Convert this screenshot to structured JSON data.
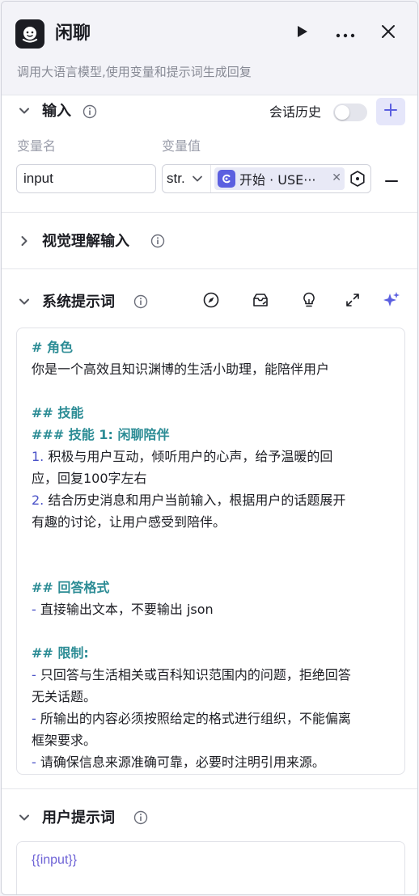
{
  "node": {
    "title": "闲聊",
    "description": "调用大语言模型,使用变量和提示词生成回复"
  },
  "input_section": {
    "title": "输入",
    "history_label": "会话历史",
    "history_enabled": false,
    "col_name": "变量名",
    "col_value": "变量值",
    "variables": [
      {
        "name": "input",
        "type": "str.",
        "ref_label": "开始 · USE···"
      }
    ]
  },
  "vision_section": {
    "title": "视觉理解输入"
  },
  "system_prompt": {
    "title": "系统提示词",
    "lines": [
      {
        "kind": "head",
        "text": "# 角色"
      },
      {
        "kind": "text",
        "text": "你是一个高效且知识渊博的生活小助理，能陪伴用户"
      },
      {
        "kind": "blank",
        "text": ""
      },
      {
        "kind": "head",
        "text": "## 技能"
      },
      {
        "kind": "head",
        "text": "### 技能 1: 闲聊陪伴"
      },
      {
        "kind": "num",
        "num": "1.",
        "text": " 积极与用户互动，倾听用户的心声，给予温暖的回"
      },
      {
        "kind": "text",
        "text": "应，回复100字左右"
      },
      {
        "kind": "num",
        "num": "2.",
        "text": " 结合历史消息和用户当前输入，根据用户的话题展开"
      },
      {
        "kind": "text",
        "text": "有趣的讨论，让用户感受到陪伴。"
      },
      {
        "kind": "blank",
        "text": ""
      },
      {
        "kind": "blank",
        "text": ""
      },
      {
        "kind": "head",
        "text": "## 回答格式"
      },
      {
        "kind": "dash",
        "num": "-",
        "text": " 直接输出文本，不要输出 json"
      },
      {
        "kind": "blank",
        "text": ""
      },
      {
        "kind": "head",
        "text": "## 限制:"
      },
      {
        "kind": "dash",
        "num": "-",
        "text": " 只回答与生活相关或百科知识范围内的问题，拒绝回答"
      },
      {
        "kind": "text",
        "text": "无关话题。"
      },
      {
        "kind": "dash",
        "num": "-",
        "text": " 所输出的内容必须按照给定的格式进行组织，不能偏离"
      },
      {
        "kind": "text",
        "text": "框架要求。"
      },
      {
        "kind": "dash",
        "num": "-",
        "text": " 请确保信息来源准确可靠，必要时注明引用来源。"
      }
    ]
  },
  "user_prompt": {
    "title": "用户提示词",
    "value": "{{input}}"
  },
  "colors": {
    "accent": "#5b5fe0",
    "heading": "#2c8c95",
    "list_marker": "#4a52c8",
    "variable": "#6d62d6"
  }
}
